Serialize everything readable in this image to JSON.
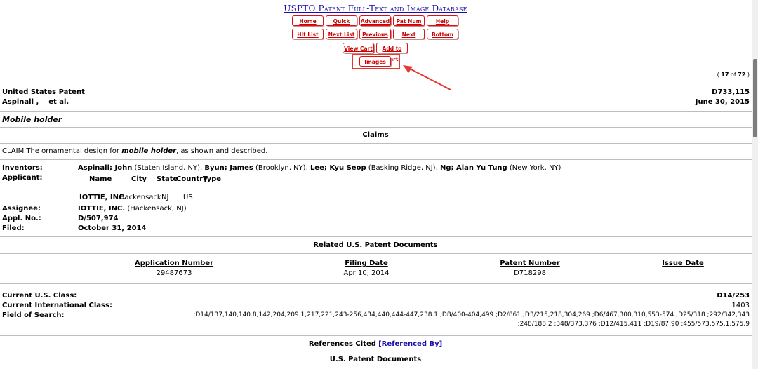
{
  "page_title": "USPTO Patent Full-Text and Image Database",
  "nav_row1": [
    "Home",
    "Quick",
    "Advanced",
    "Pat Num",
    "Help"
  ],
  "nav_row2": [
    "Hit List",
    "Next List",
    "Previous",
    "Next",
    "Bottom"
  ],
  "nav_row3": [
    "View Cart",
    "Add to Cart"
  ],
  "images_button": "Images",
  "result_position": {
    "prefix": "( ",
    "current": "17",
    "of": " of ",
    "total": "72",
    "suffix": " )"
  },
  "patent": {
    "country_label": "United States Patent",
    "number": "D733,115",
    "inventor_short": "Aspinall ,    et al.",
    "date": "June 30, 2015",
    "title": "Mobile holder"
  },
  "claims": {
    "heading": "Claims",
    "text_before": "CLAIM The ornamental design for ",
    "text_em": "mobile holder",
    "text_after": ", as shown and described."
  },
  "details": {
    "inventors_label": "Inventors:",
    "inventors": [
      {
        "name": "Aspinall; John",
        "loc": " (Staten Island, NY), "
      },
      {
        "name": "Byun; James",
        "loc": " (Brooklyn, NY), "
      },
      {
        "name": "Lee; Kyu Seop",
        "loc": " (Basking Ridge, NJ), "
      },
      {
        "name": "Ng; Alan Yu Tung",
        "loc": " (New York, NY)"
      }
    ],
    "applicant_label": "Applicant:",
    "applicant_headers": [
      "Name",
      "City",
      "State",
      "Country",
      "Type"
    ],
    "applicant_row": {
      "name": "IOTTIE, INC.",
      "city": "Hackensack",
      "state": "NJ",
      "country": "US"
    },
    "assignee_label": "Assignee:",
    "assignee_name": "IOTTIE, INC.",
    "assignee_loc": " (Hackensack, NJ)",
    "appl_no_label": "Appl. No.:",
    "appl_no": "D/507,974",
    "filed_label": "Filed:",
    "filed": "October 31, 2014"
  },
  "related_docs": {
    "heading": "Related U.S. Patent Documents",
    "headers": [
      "Application Number",
      "Filing Date",
      "Patent Number",
      "Issue Date"
    ],
    "row": [
      "29487673",
      "Apr 10, 2014",
      "D718298",
      ""
    ]
  },
  "classification": {
    "us_class_label": "Current U.S. Class:",
    "us_class": "D14/253",
    "intl_class_label": "Current International Class:",
    "intl_class": "1403",
    "field_label": "Field of Search:",
    "field_line1": ";D14/137,140,140.8,142,204,209.1,217,221,243-256,434,440,444-447,238.1 ;D8/400-404,499 ;D2/861 ;D3/215,218,304,269 ;D6/467,300,310,553-574 ;D25/318 ;292/342,343",
    "field_line2": ";248/188.2 ;348/373,376 ;D12/415,411 ;D19/87,90 ;455/573,575.1,575.9"
  },
  "references": {
    "heading": "References Cited",
    "referenced_by": "[Referenced By]",
    "us_docs_heading": "U.S. Patent Documents"
  }
}
